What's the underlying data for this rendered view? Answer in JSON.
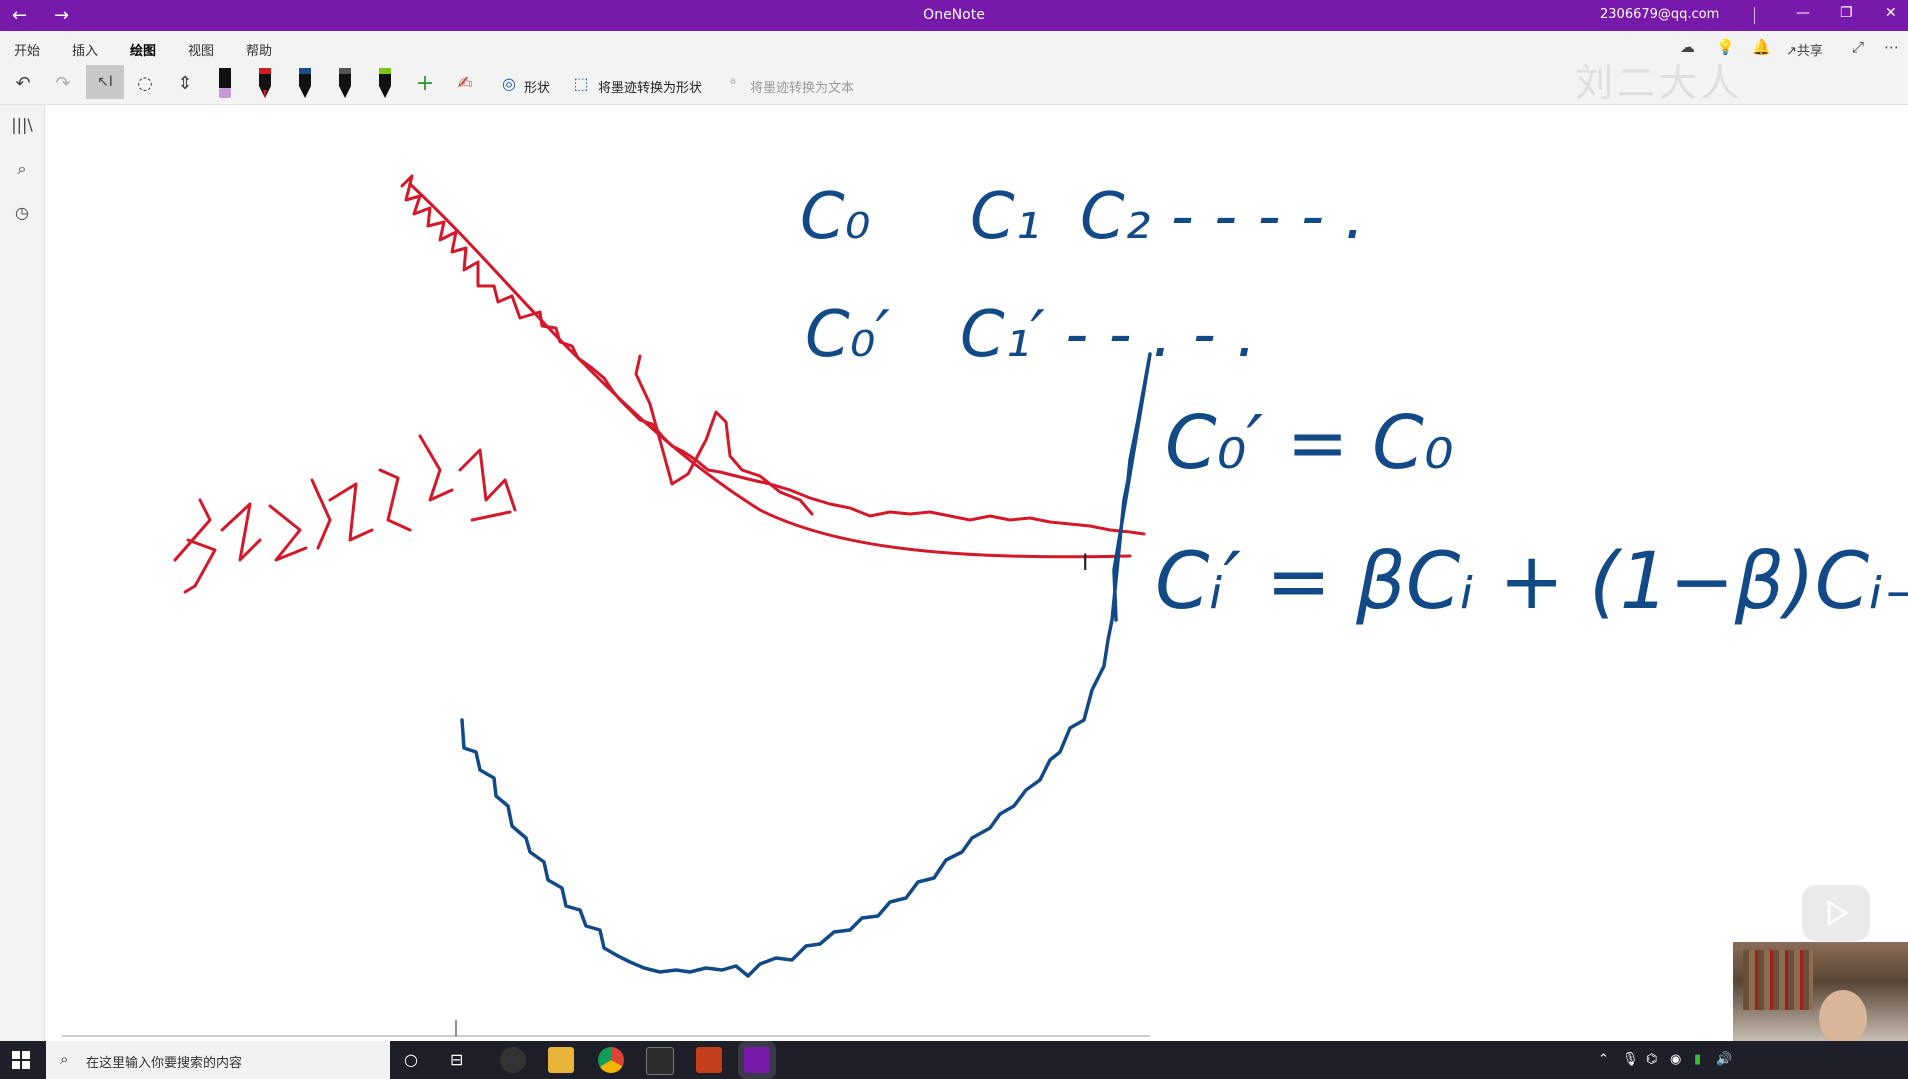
{
  "titlebar": {
    "back_icon": "back-arrow-icon",
    "forward_icon": "forward-arrow-icon",
    "title": "OneNote",
    "account": "2306679@qq.com"
  },
  "menu": {
    "tabs": [
      "开始",
      "插入",
      "绘图",
      "视图",
      "帮助"
    ],
    "active_tab": "绘图",
    "share_label": "共享"
  },
  "ribbon": {
    "shape_label": "形状",
    "ink_to_shape_label": "将墨迹转换为形状",
    "ink_to_text_label": "将墨迹转换为文本",
    "pens": [
      {
        "name": "highlighter",
        "color": "#c79ad6"
      },
      {
        "name": "red-pen",
        "color": "#d01c1c"
      },
      {
        "name": "blue-pen",
        "color": "#1a4f8b"
      },
      {
        "name": "black-pen",
        "color": "#111111"
      },
      {
        "name": "green-pen",
        "color": "#7cc31e"
      }
    ]
  },
  "watermark": "刘二大人",
  "ink_colors": {
    "red": "#d4182a",
    "blue": "#114a86"
  },
  "taskbar": {
    "search_placeholder": "在这里输入你要搜索的内容"
  }
}
